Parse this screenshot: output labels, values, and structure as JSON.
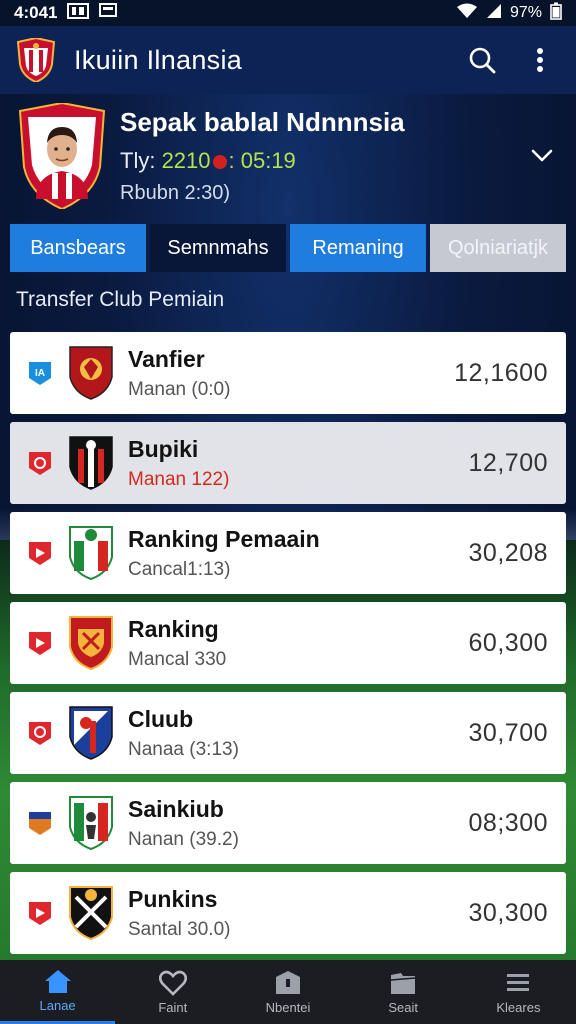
{
  "status_bar": {
    "time": "4:041",
    "battery": "97%"
  },
  "app_bar": {
    "title": "Ikuiin Ilnansia"
  },
  "header": {
    "title": "Sepak bablal Ndnnnsia",
    "time_prefix": "Tly: ",
    "time_a": "2210",
    "time_b": ": 05:19",
    "subtitle": "Rbubn 2:30)"
  },
  "tabs": [
    {
      "label": "Bansbears"
    },
    {
      "label": "Semnmahs"
    },
    {
      "label": "Remaning"
    },
    {
      "label": "Qolniariatjk"
    }
  ],
  "section_title": "Transfer Club Pemiain",
  "rows": [
    {
      "name": "Vanfier",
      "sub": "Manan (0:0)",
      "value": "12,1600",
      "badge_color": "#1a8fe0",
      "crest_colors": [
        "#b3171c",
        "#f1c040"
      ]
    },
    {
      "name": "Bupiki",
      "sub": "Manan 122)",
      "value": "12,700",
      "badge_color": "#e0262d",
      "crest_colors": [
        "#111111",
        "#d7261f"
      ]
    },
    {
      "name": "Ranking Pemaain",
      "sub": "Cancal1:13)",
      "value": "30,208",
      "badge_color": "#e0262d",
      "crest_colors": [
        "#1e8a3a",
        "#d7261f"
      ]
    },
    {
      "name": "Ranking",
      "sub": "Mancal 330",
      "value": "60,300",
      "badge_color": "#e0262d",
      "crest_colors": [
        "#c21b1f",
        "#f2b43a"
      ]
    },
    {
      "name": "Cluub",
      "sub": "Nanaa (3:13)",
      "value": "30,700",
      "badge_color": "#e0262d",
      "crest_colors": [
        "#1b3f9a",
        "#d7261f"
      ]
    },
    {
      "name": "Sainkiub",
      "sub": "Nanan (39.2)",
      "value": "08;300",
      "badge_color": "#e07a20",
      "crest_colors": [
        "#1e8a3a",
        "#d7261f"
      ]
    },
    {
      "name": "Punkins",
      "sub": "Santal 30.0)",
      "value": "30,300",
      "badge_color": "#e0262d",
      "crest_colors": [
        "#111111",
        "#f2b43a"
      ]
    }
  ],
  "bottom_nav": [
    {
      "label": "Lanae",
      "icon": "home-icon"
    },
    {
      "label": "Faint",
      "icon": "heart-icon"
    },
    {
      "label": "Nbentei",
      "icon": "box-icon"
    },
    {
      "label": "Seait",
      "icon": "folder-icon"
    },
    {
      "label": "Kleares",
      "icon": "list-icon"
    }
  ],
  "colors": {
    "accent": "#1f7de0",
    "appbar": "#0d2255",
    "live_dot": "#d32020",
    "time_highlight": "#b6e24a"
  }
}
